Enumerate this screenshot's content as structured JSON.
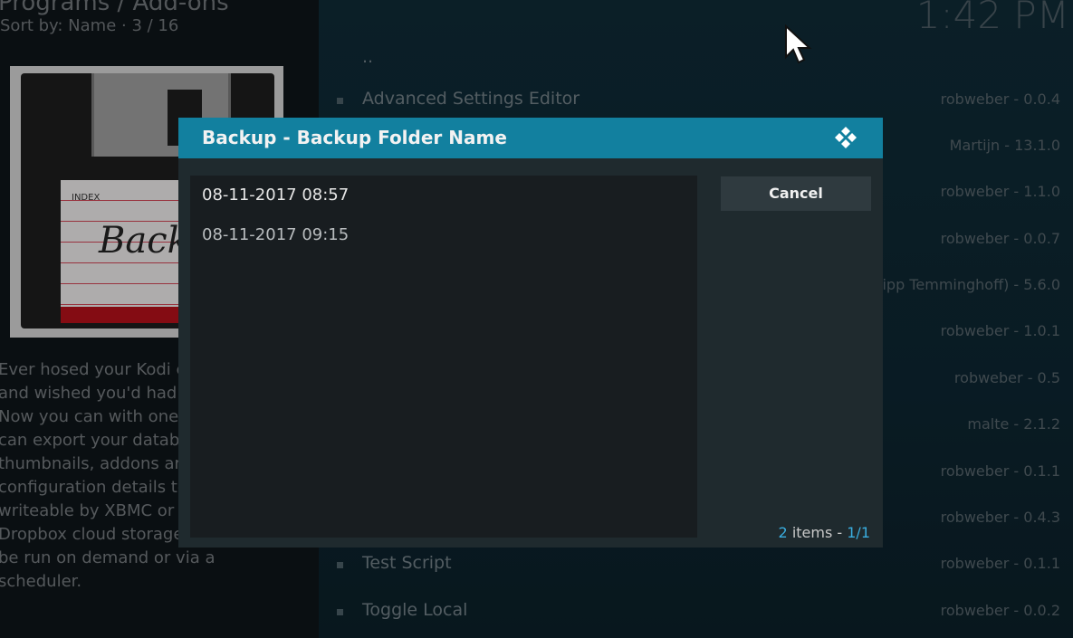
{
  "background": {
    "breadcrumb": "Programs / Add-ons",
    "sort_info": "Sort by: Name  ·  3 / 16",
    "clock": "1:42 PM",
    "description": "Ever hosed your Kodi c\nand wished you'd had\nNow you can with one\ncan export your databa\nthumbnails, addons ar\nconfiguration details to\nwriteable by XBMC or d\nDropbox cloud storage\nbe run on demand or via a\nscheduler.",
    "thumbnail": {
      "index_label": "INDEX",
      "script_text": "Backup"
    },
    "list": [
      {
        "name": "..",
        "meta": ""
      },
      {
        "name": "Advanced Settings Editor",
        "meta": "robweber - 0.0.4"
      },
      {
        "name": "",
        "meta": "Martijn - 13.1.0"
      },
      {
        "name": "",
        "meta": "robweber - 1.1.0"
      },
      {
        "name": "",
        "meta": "robweber - 0.0.7"
      },
      {
        "name": "",
        "meta": "ipp Temminghoff) - 5.6.0"
      },
      {
        "name": "",
        "meta": "robweber - 1.0.1"
      },
      {
        "name": "",
        "meta": "robweber - 0.5"
      },
      {
        "name": "",
        "meta": "malte - 2.1.2"
      },
      {
        "name": "",
        "meta": "robweber - 0.1.1"
      },
      {
        "name": "",
        "meta": "robweber - 0.4.3"
      },
      {
        "name": "Test Script",
        "meta": "robweber - 0.1.1"
      },
      {
        "name": "Toggle Local",
        "meta": "robweber - 0.0.2"
      }
    ]
  },
  "dialog": {
    "title": "Backup - Backup Folder Name",
    "items": [
      "08-11-2017 08:57",
      "08-11-2017 09:15"
    ],
    "cancel_label": "Cancel",
    "count": "2",
    "count_label": " items - ",
    "page": "1/1"
  },
  "colors": {
    "header": "#12809f",
    "accent": "#3aaee0"
  },
  "icons": {
    "logo": "kodi-logo-icon",
    "cursor": "mouse-pointer-icon"
  }
}
